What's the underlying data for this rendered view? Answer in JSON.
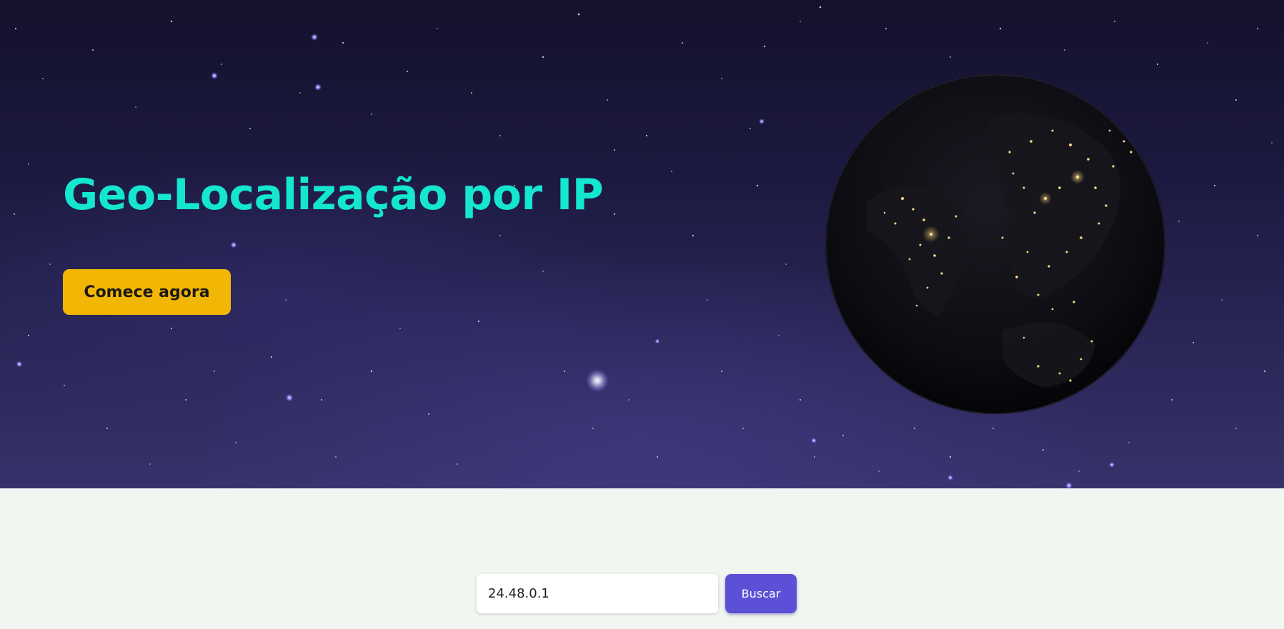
{
  "hero": {
    "title": "Geo-Localização por IP",
    "cta_label": "Comece agora",
    "background_image": "starry-night-sky",
    "globe_image": "earth-night-lights-globe"
  },
  "search": {
    "input_value": "24.48.0.1",
    "button_label": "Buscar"
  },
  "colors": {
    "title": "#14e6d0",
    "cta_background": "#f2b705",
    "search_button": "#5b50d6",
    "page_background": "#f1f6f1"
  }
}
